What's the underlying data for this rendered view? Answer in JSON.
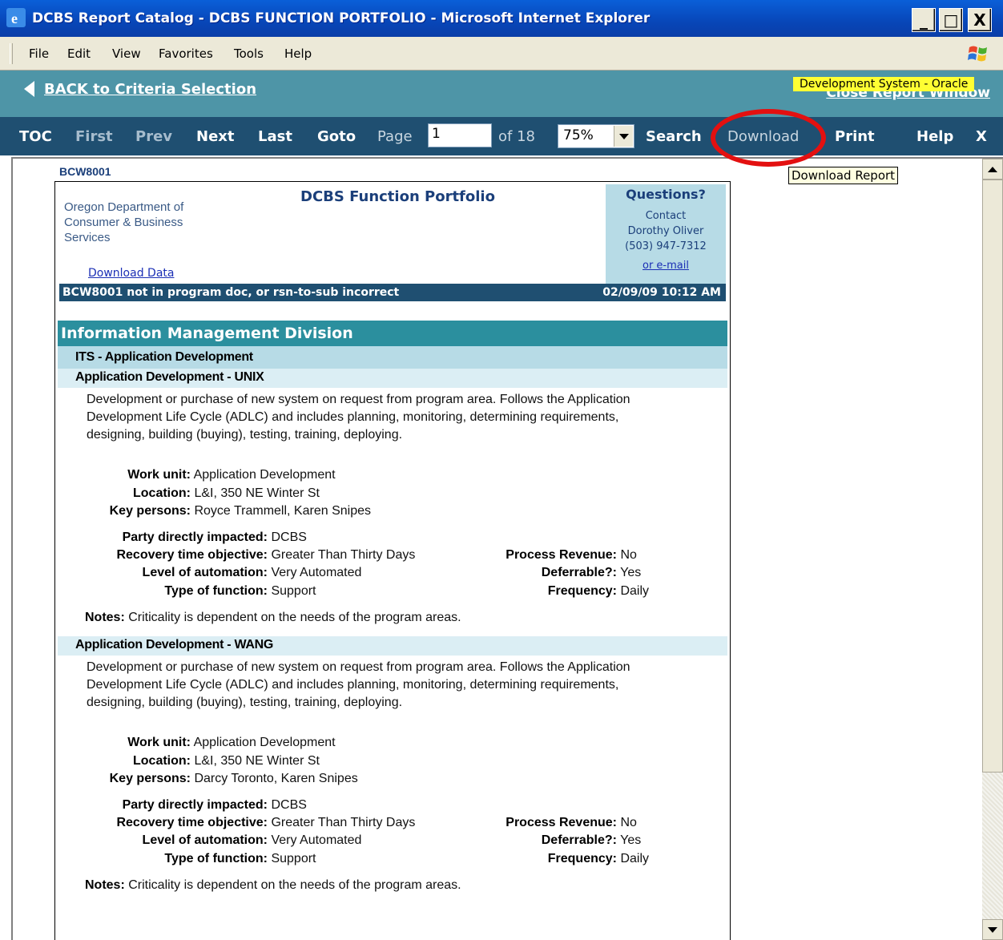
{
  "window": {
    "title": "DCBS Report Catalog - DCBS FUNCTION PORTFOLIO - Microsoft Internet Explorer",
    "minimize": "_",
    "maximize": "□",
    "close": "X"
  },
  "menu": {
    "items": [
      "File",
      "Edit",
      "View",
      "Favorites",
      "Tools",
      "Help"
    ]
  },
  "report_header": {
    "back_link": "BACK to Criteria Selection",
    "dev_badge": "Development System - Oracle",
    "close_link": "Close Report Window"
  },
  "toolbar": {
    "toc": "TOC",
    "first": "First",
    "prev": "Prev",
    "next": "Next",
    "last": "Last",
    "goto": "Goto",
    "page_label": "Page",
    "page_value": "1",
    "of_label": "of 18",
    "zoom": "75%",
    "search": "Search",
    "download": "Download",
    "print": "Print",
    "help": "Help",
    "close": "X",
    "tooltip": "Download Report"
  },
  "report": {
    "code": "BCW8001",
    "org_name": "Oregon Department of Consumer & Business Services",
    "download_data": "Download Data",
    "title": "DCBS Function Portfolio",
    "questions": {
      "title": "Questions?",
      "contact": "Contact",
      "name": "Dorothy Oliver",
      "phone": "(503) 947-7312",
      "email": "or e-mail"
    },
    "status_left": "BCW8001 not in program doc, or rsn-to-sub incorrect",
    "status_right": "02/09/09 10:12 AM",
    "division": "Information Management Division",
    "unit": "ITS - Application Development",
    "functions": [
      {
        "name": "Application Development - UNIX",
        "description": "Development or purchase of new system on request from program area.  Follows the Application Development Life Cycle (ADLC) and includes planning, monitoring, determining requirements, designing, building (buying), testing, training, deploying.",
        "work_unit": "Application Development",
        "location": "L&I, 350 NE Winter St",
        "key_persons": "Royce Trammell, Karen Snipes",
        "party": "DCBS",
        "rto": "Greater Than Thirty Days",
        "automation": "Very Automated",
        "type": "Support",
        "revenue": "No",
        "deferrable": "Yes",
        "frequency": "Daily",
        "notes": "Criticality is dependent on the needs of the program areas."
      },
      {
        "name": "Application Development - WANG",
        "description": "Development or purchase of new system on request from program area.  Follows the Application Development Life Cycle (ADLC) and includes planning, monitoring, determining requirements, designing, building (buying), testing, training, deploying.",
        "work_unit": "Application Development",
        "location": "L&I, 350 NE Winter St",
        "key_persons": "Darcy Toronto, Karen Snipes",
        "party": "DCBS",
        "rto": "Greater Than Thirty Days",
        "automation": "Very Automated",
        "type": "Support",
        "revenue": "No",
        "deferrable": "Yes",
        "frequency": "Daily",
        "notes": "Criticality is dependent on the needs of the program areas."
      }
    ],
    "labels": {
      "work_unit": "Work unit:",
      "location": "Location:",
      "key_persons": "Key persons:",
      "party": "Party directly impacted:",
      "rto": "Recovery time objective:",
      "automation": "Level of automation:",
      "type": "Type of function:",
      "revenue": "Process Revenue:",
      "deferrable": "Deferrable?:",
      "frequency": "Frequency:",
      "notes": "Notes:"
    }
  },
  "colors": {
    "titlebar": "#0a5fd8",
    "teal_header": "#4e95a7",
    "navbar": "#1f4f71",
    "division": "#2b8f9e",
    "unit_band": "#b7dbe6",
    "function_band": "#dbeef4",
    "highlight_circle": "#e31010"
  },
  "icons": [
    "ie-icon",
    "windows-logo-icon",
    "back-arrow-icon",
    "dropdown-arrow-icon",
    "scroll-up-icon",
    "scroll-down-icon"
  ]
}
